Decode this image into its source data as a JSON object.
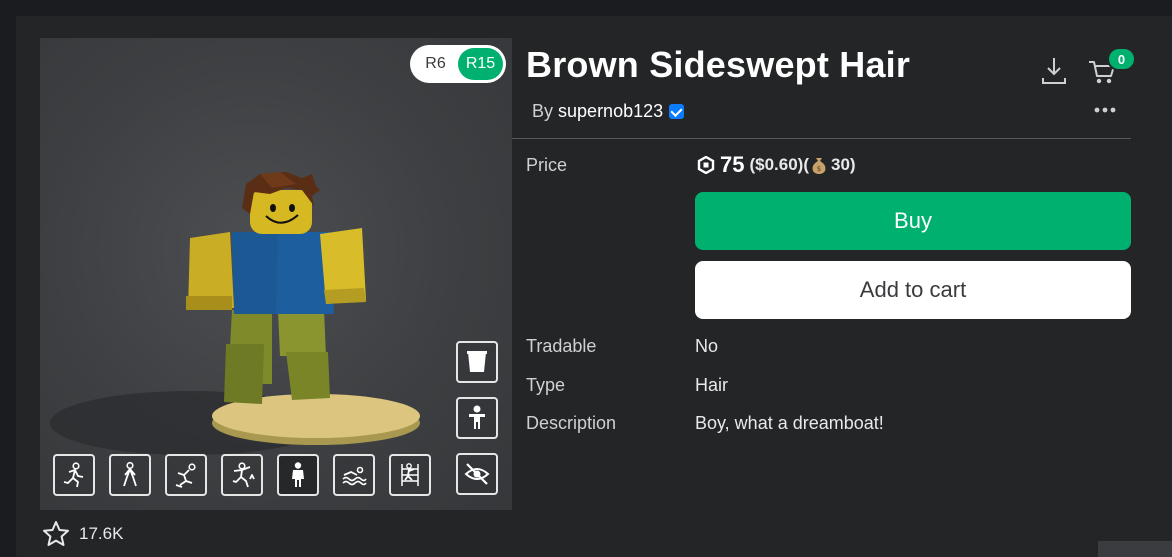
{
  "item": {
    "title": "Brown Sideswept Hair",
    "by_prefix": "By",
    "creator": "supernob123",
    "favorites": "17.6K"
  },
  "viewer": {
    "rig_options": [
      "R6",
      "R15"
    ],
    "rig_selected": "R15",
    "side_buttons": [
      "outfit-icon",
      "body-icon",
      "hide-icon"
    ],
    "animation_buttons": [
      "run-icon",
      "walk-icon",
      "fall-icon",
      "climb-jump-icon",
      "idle-icon",
      "swim-icon",
      "climb-icon"
    ],
    "animation_selected": "idle-icon"
  },
  "header": {
    "cart_count": "0"
  },
  "details": {
    "price_label": "Price",
    "price_robux": "75",
    "price_usd": "($0.60)(",
    "price_alt": "30)",
    "buy_label": "Buy",
    "add_to_cart_label": "Add to cart",
    "tradable_label": "Tradable",
    "tradable_value": "No",
    "type_label": "Type",
    "type_value": "Hair",
    "description_label": "Description",
    "description_value": "Boy, what a dreamboat!"
  },
  "colors": {
    "accent_green": "#00b06f",
    "background": "#232527",
    "verified_blue": "#0c7cff"
  }
}
